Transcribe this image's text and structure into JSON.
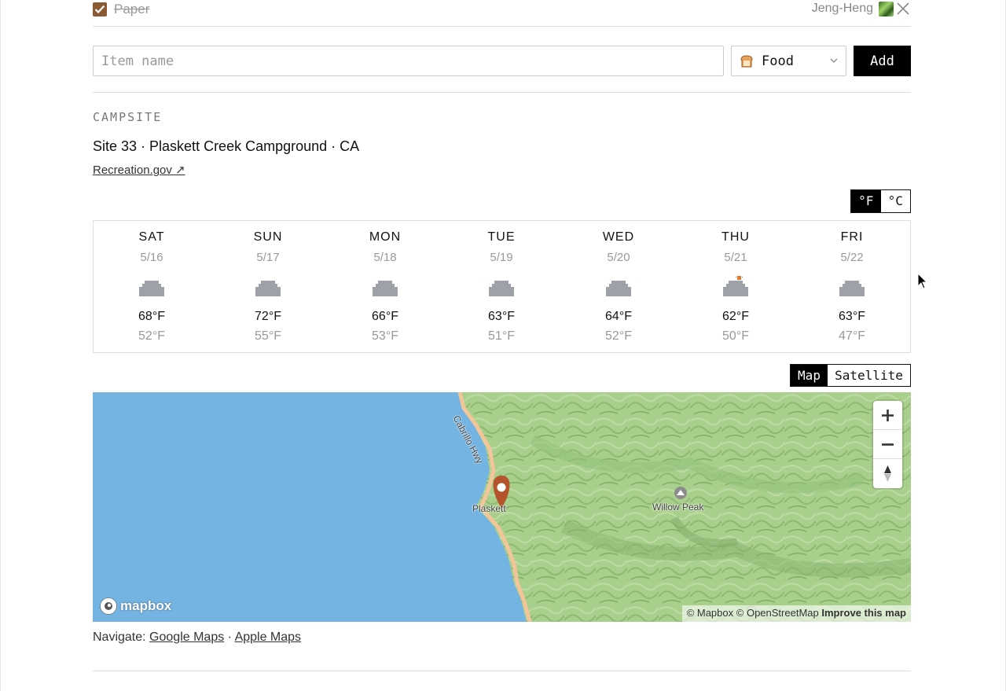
{
  "item": {
    "name": "Paper",
    "checked": true,
    "owner": "Jeng-Heng"
  },
  "add_form": {
    "placeholder": "Item name",
    "category": "Food",
    "add_label": "Add"
  },
  "campsite": {
    "section_label": "CAMPSITE",
    "name": "Site 33 · Plaskett Creek Campground · CA",
    "link_label": "Recreation.gov ↗"
  },
  "unit_toggle": {
    "fahrenheit": "°F",
    "celsius": "°C",
    "selected": "°F"
  },
  "forecast": [
    {
      "dow": "SAT",
      "date": "5/16",
      "high": "68°F",
      "low": "52°F",
      "icon": "cloud-icon"
    },
    {
      "dow": "SUN",
      "date": "5/17",
      "high": "72°F",
      "low": "55°F",
      "icon": "cloud-icon"
    },
    {
      "dow": "MON",
      "date": "5/18",
      "high": "66°F",
      "low": "53°F",
      "icon": "cloud-icon"
    },
    {
      "dow": "TUE",
      "date": "5/19",
      "high": "63°F",
      "low": "51°F",
      "icon": "cloud-icon"
    },
    {
      "dow": "WED",
      "date": "5/20",
      "high": "64°F",
      "low": "52°F",
      "icon": "cloud-icon"
    },
    {
      "dow": "THU",
      "date": "5/21",
      "high": "62°F",
      "low": "50°F",
      "icon": "partly-cloudy-icon"
    },
    {
      "dow": "FRI",
      "date": "5/22",
      "high": "63°F",
      "low": "47°F",
      "icon": "cloud-icon"
    }
  ],
  "map_toggle": {
    "map": "Map",
    "satellite": "Satellite",
    "selected": "Map"
  },
  "map": {
    "labels": {
      "highway": "Cabrillo Hwy",
      "pin": "Plaskett",
      "peak": "Willow Peak"
    },
    "logo": "mapbox",
    "attribution": {
      "mapbox": "© Mapbox",
      "osm": "© OpenStreetMap",
      "improve": "Improve this map"
    },
    "colors": {
      "water": "#74b4e2",
      "land": "#a9cf8c",
      "pin": "#b5532a"
    }
  },
  "navigate": {
    "prefix": "Navigate:",
    "google": "Google Maps",
    "separator": "·",
    "apple": "Apple Maps"
  }
}
